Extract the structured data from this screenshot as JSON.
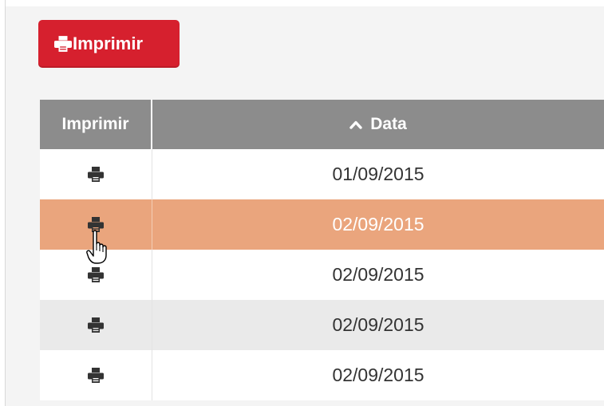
{
  "toolbar": {
    "print_label": "Imprimir",
    "print_icon": "printer-icon",
    "accent": "#d6202e"
  },
  "table": {
    "columns": [
      "Imprimir",
      "Data"
    ],
    "sort_icon": "chevron-up-icon",
    "row_icon": "printer-icon",
    "rows": [
      {
        "date": "01/09/2015",
        "state": "normal"
      },
      {
        "date": "02/09/2015",
        "state": "hover"
      },
      {
        "date": "02/09/2015",
        "state": "normal"
      },
      {
        "date": "02/09/2015",
        "state": "alternate"
      },
      {
        "date": "02/09/2015",
        "state": "normal"
      }
    ],
    "highlight_color": "#eaa57d",
    "header_color": "#8c8c8c"
  },
  "cursor": "hand-pointer-icon"
}
